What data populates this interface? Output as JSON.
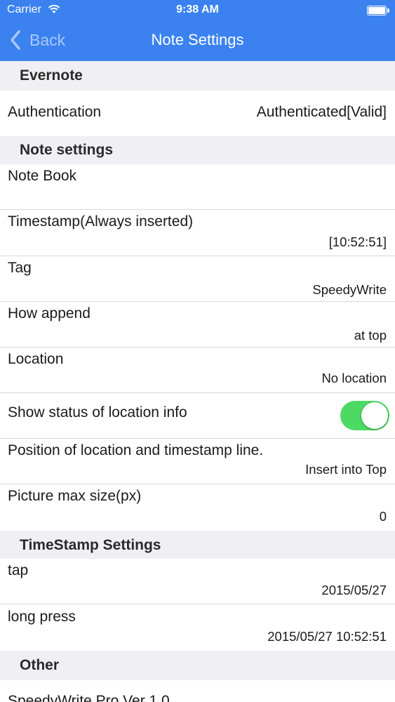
{
  "status_bar": {
    "carrier": "Carrier",
    "time": "9:38 AM"
  },
  "nav": {
    "back_label": "Back",
    "title": "Note Settings"
  },
  "sections": {
    "evernote": "Evernote",
    "note_settings": "Note settings",
    "timestamp_settings": "TimeStamp Settings",
    "other": "Other"
  },
  "rows": {
    "authentication": {
      "label": "Authentication",
      "value": "Authenticated[Valid]"
    },
    "note_book": {
      "label": "Note Book",
      "value": ""
    },
    "timestamp": {
      "label": "Timestamp(Always inserted)",
      "value": "[10:52:51]"
    },
    "tag": {
      "label": "Tag",
      "value": "SpeedyWrite"
    },
    "how_append": {
      "label": "How append",
      "value": "at top"
    },
    "location": {
      "label": "Location",
      "value": "No location"
    },
    "show_status": {
      "label": "Show status of location info",
      "toggle_on": true
    },
    "position": {
      "label": "Position of location and timestamp line.",
      "value": "Insert into Top"
    },
    "picture_max": {
      "label": "Picture max size(px)",
      "value": "0"
    },
    "tap": {
      "label": "tap",
      "value": "2015/05/27"
    },
    "long_press": {
      "label": "long press",
      "value": "2015/05/27 10:52:51"
    },
    "version": {
      "label": "SpeedyWrite Pro Ver 1.0"
    }
  },
  "colors": {
    "nav_bar": "#3b82f0",
    "toggle_on": "#4cd964",
    "background": "#efeff4"
  },
  "icons": {
    "back": "chevron-left-icon",
    "wifi": "wifi-icon",
    "battery": "battery-icon"
  }
}
